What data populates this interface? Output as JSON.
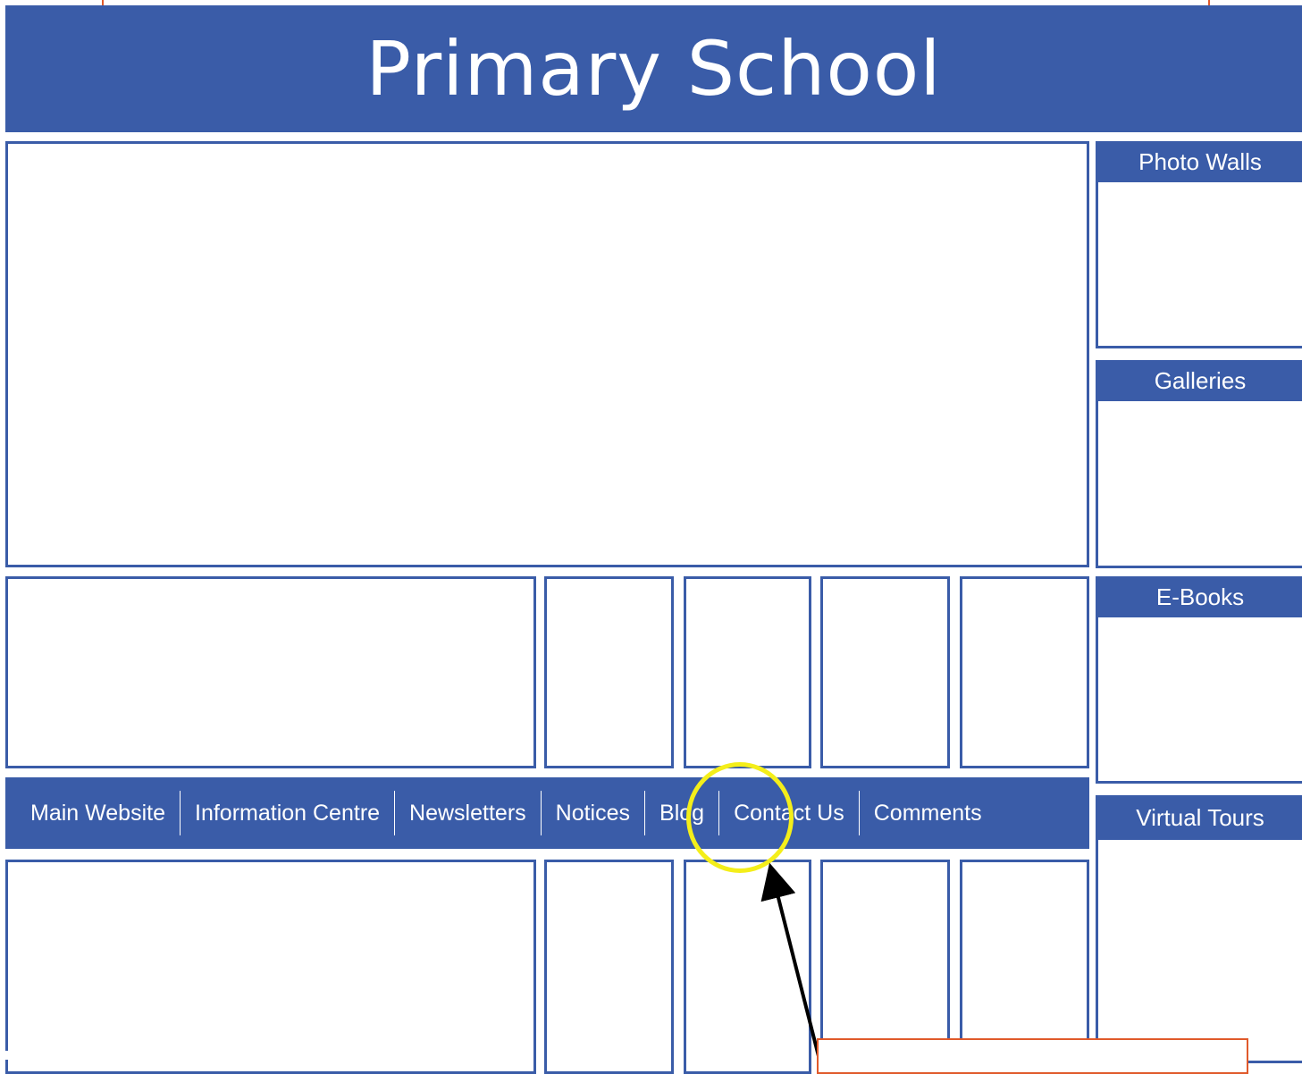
{
  "header": {
    "title": "Primary School"
  },
  "nav": {
    "items": [
      {
        "label": "Main Website"
      },
      {
        "label": "Information Centre"
      },
      {
        "label": "Newsletters"
      },
      {
        "label": "Notices"
      },
      {
        "label": "Blog"
      },
      {
        "label": "Contact Us"
      },
      {
        "label": "Comments"
      }
    ],
    "highlighted": "Blog"
  },
  "sidebar": {
    "sections": [
      {
        "title": "Photo Walls"
      },
      {
        "title": "Galleries"
      },
      {
        "title": "E-Books"
      },
      {
        "title": "Virtual Tours"
      }
    ]
  },
  "colors": {
    "primary": "#3a5ca8",
    "highlight": "#f4ee1a",
    "callout_border": "#e05a2b",
    "arrow": "#000000"
  }
}
